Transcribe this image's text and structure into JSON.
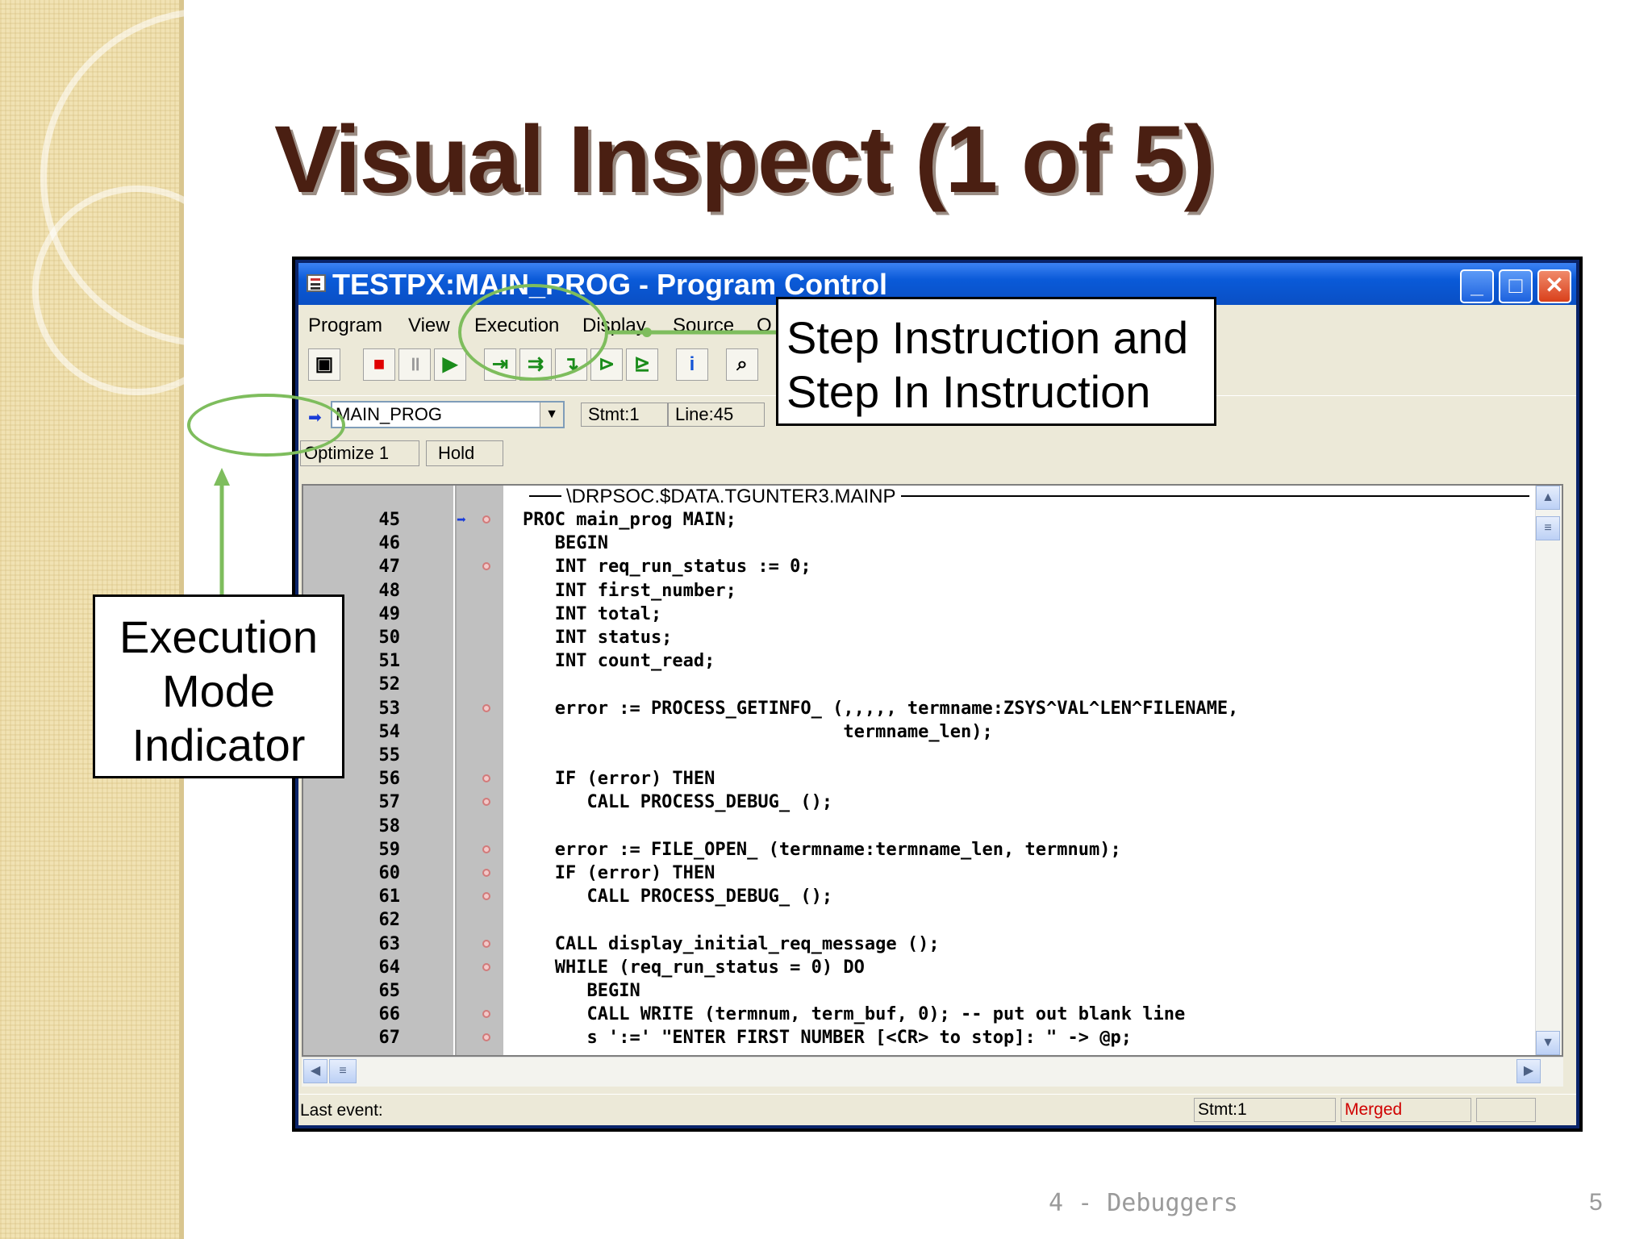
{
  "slide": {
    "title": "Visual Inspect (1 of 5)",
    "footer": "4 - Debuggers",
    "page_number": "5"
  },
  "window": {
    "title": "TESTPX:MAIN_PROG - Program Control",
    "min_icon": "minimize-icon",
    "max_icon": "maximize-icon",
    "close_icon": "close-icon",
    "menu": [
      "Program",
      "View",
      "Execution",
      "Display",
      "Source",
      "O"
    ],
    "toolbar": [
      "camera-icon",
      "stop-icon",
      "pause-icon",
      "run-icon",
      "step-icon",
      "step-over-icon",
      "step-in-icon",
      "step-instruction-icon",
      "step-in-instruction-icon",
      "info-icon",
      "search-icon"
    ],
    "procedure": "MAIN_PROG",
    "stmt": "Stmt:1",
    "line": "Line:45",
    "optimize": "Optimize 1",
    "hold": "Hold",
    "path": "\\DRPSOC.$DATA.TGUNTER3.MAINP",
    "status_last_event": "Last event:",
    "status_stmt": "Stmt:1",
    "status_merged": "Merged",
    "accent_color": "#0a4fc4",
    "merged_color": "#d00000"
  },
  "source_lines": [
    {
      "n": "45",
      "code": "PROC main_prog MAIN;"
    },
    {
      "n": "46",
      "code": "   BEGIN"
    },
    {
      "n": "47",
      "code": "   INT req_run_status := 0;"
    },
    {
      "n": "48",
      "code": "   INT first_number;"
    },
    {
      "n": "49",
      "code": "   INT total;"
    },
    {
      "n": "50",
      "code": "   INT status;"
    },
    {
      "n": "51",
      "code": "   INT count_read;"
    },
    {
      "n": "52",
      "code": ""
    },
    {
      "n": "53",
      "code": "   error := PROCESS_GETINFO_ (,,,,, termname:ZSYS^VAL^LEN^FILENAME,"
    },
    {
      "n": "54",
      "code": "                              termname_len);"
    },
    {
      "n": "55",
      "code": ""
    },
    {
      "n": "56",
      "code": "   IF (error) THEN"
    },
    {
      "n": "57",
      "code": "      CALL PROCESS_DEBUG_ ();"
    },
    {
      "n": "58",
      "code": ""
    },
    {
      "n": "59",
      "code": "   error := FILE_OPEN_ (termname:termname_len, termnum);"
    },
    {
      "n": "60",
      "code": "   IF (error) THEN"
    },
    {
      "n": "61",
      "code": "      CALL PROCESS_DEBUG_ ();"
    },
    {
      "n": "62",
      "code": ""
    },
    {
      "n": "63",
      "code": "   CALL display_initial_req_message ();"
    },
    {
      "n": "64",
      "code": "   WHILE (req_run_status = 0) DO"
    },
    {
      "n": "65",
      "code": "      BEGIN"
    },
    {
      "n": "66",
      "code": "      CALL WRITE (termnum, term_buf, 0); -- put out blank line"
    },
    {
      "n": "67",
      "code": "      s ':=' \"ENTER FIRST NUMBER [<CR> to stop]: \" -> @p;"
    }
  ],
  "callouts": {
    "step": "Step Instruction and Step In Instruction",
    "exec": "Execution Mode Indicator"
  }
}
